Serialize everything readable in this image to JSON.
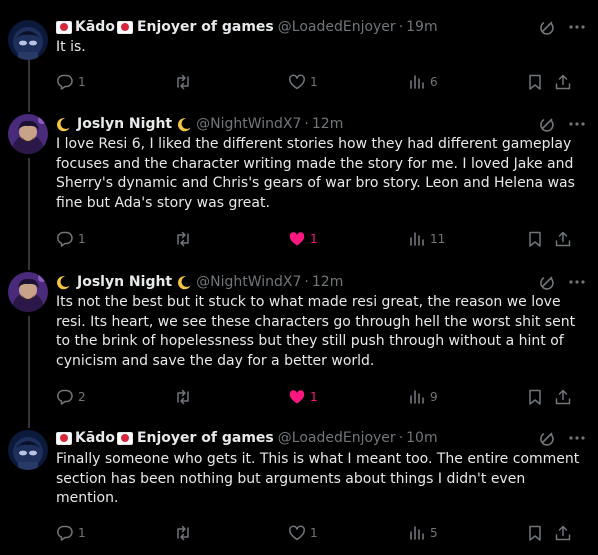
{
  "tweets": [
    {
      "author": {
        "name": "Kādo",
        "suffix": "Enjoyer of games",
        "handle": "@LoadedEnjoyer",
        "decoration": "japan-flag-emoji"
      },
      "time": "19m",
      "text": "It is.",
      "stats": {
        "replies": "1",
        "retweets": "",
        "likes": "1",
        "views": "6",
        "liked": false
      },
      "avatar_colors": [
        "#0b1a3a",
        "#1e2f5c",
        "#b8c4df"
      ]
    },
    {
      "author": {
        "name": "Joslyn Night",
        "suffix": "",
        "handle": "@NightWindX7",
        "decoration": "crescent-moon-emoji"
      },
      "time": "12m",
      "text": "I love Resi 6, I liked the different stories how they had different gameplay focuses and the character writing made the story for me. I loved Jake and Sherry's dynamic and Chris's gears of war bro story. Leon and Helena was fine but Ada's story was great.",
      "stats": {
        "replies": "1",
        "retweets": "",
        "likes": "1",
        "views": "11",
        "liked": true
      },
      "avatar_colors": [
        "#4a2a7a",
        "#8c5cc0",
        "#c9a28a"
      ]
    },
    {
      "author": {
        "name": "Joslyn Night",
        "suffix": "",
        "handle": "@NightWindX7",
        "decoration": "crescent-moon-emoji"
      },
      "time": "12m",
      "text": "Its not the best but it stuck to what made resi great, the reason we love resi. Its heart, we see these characters go through hell the worst shit sent to the brink of hopelessness but they still push through without a hint of cynicism and save the day for a better world.",
      "stats": {
        "replies": "2",
        "retweets": "",
        "likes": "1",
        "views": "9",
        "liked": true
      },
      "avatar_colors": [
        "#4a2a7a",
        "#8c5cc0",
        "#c9a28a"
      ]
    },
    {
      "author": {
        "name": "Kādo",
        "suffix": "Enjoyer of games",
        "handle": "@LoadedEnjoyer",
        "decoration": "japan-flag-emoji"
      },
      "time": "10m",
      "text": "Finally someone who gets it. This is what I meant too. The entire comment section has been nothing but arguments about things I didn't even mention.",
      "stats": {
        "replies": "1",
        "retweets": "",
        "likes": "1",
        "views": "5",
        "liked": false
      },
      "avatar_colors": [
        "#0b1a3a",
        "#1e2f5c",
        "#b8c4df"
      ]
    }
  ],
  "theme": {
    "background": "#000000",
    "text": "#e7e9ea",
    "muted": "#71767b",
    "like": "#f91880",
    "divider": "#333639"
  },
  "meta_separator": "·"
}
